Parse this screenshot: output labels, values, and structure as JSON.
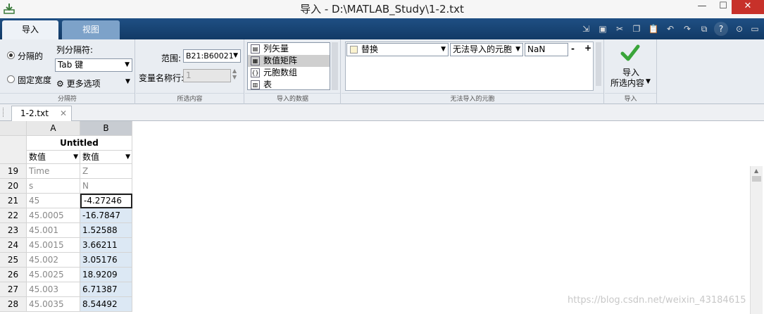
{
  "window": {
    "title": "导入 - D:\\MATLAB_Study\\1-2.txt"
  },
  "tabs": [
    {
      "label": "导入"
    },
    {
      "label": "视图"
    }
  ],
  "delimiters": {
    "delimited_label": "分隔的",
    "fixed_width_label": "固定宽度",
    "column_delimiter_label": "列分隔符:",
    "delimiter_value": "Tab 键",
    "more_options_label": "更多选项",
    "group_label": "分隔符"
  },
  "selection": {
    "range_label": "范围:",
    "range_value": "B21:B60021",
    "var_names_row_label": "变量名称行:",
    "var_names_row_value": "1",
    "group_label": "所选内容"
  },
  "output_type": {
    "items": [
      {
        "label": "列矢量"
      },
      {
        "label": "数值矩阵"
      },
      {
        "label": "元胞数组"
      },
      {
        "label": "表"
      }
    ],
    "selected_index": 1,
    "group_label": "导入的数据"
  },
  "unimportable": {
    "rule": "替换",
    "condition": "无法导入的元胞",
    "value": "NaN",
    "minus": "-",
    "plus": "+",
    "group_label": "无法导入的元胞"
  },
  "import_action": {
    "label_line1": "导入",
    "label_line2": "所选内容",
    "group_label": "导入"
  },
  "document_tab": {
    "label": "1-2.txt"
  },
  "grid": {
    "col_a": "A",
    "col_b": "B",
    "var_name": "Untitled",
    "type_a": "数值",
    "type_b": "数值",
    "rows": [
      {
        "num": "19",
        "a": "Time",
        "b": "Z"
      },
      {
        "num": "20",
        "a": "s",
        "b": "N"
      },
      {
        "num": "21",
        "a": "45",
        "b": "-4.27246"
      },
      {
        "num": "22",
        "a": "45.0005",
        "b": "-16.7847"
      },
      {
        "num": "23",
        "a": "45.001",
        "b": "1.52588"
      },
      {
        "num": "24",
        "a": "45.0015",
        "b": "3.66211"
      },
      {
        "num": "25",
        "a": "45.002",
        "b": "3.05176"
      },
      {
        "num": "26",
        "a": "45.0025",
        "b": "18.9209"
      },
      {
        "num": "27",
        "a": "45.003",
        "b": "6.71387"
      },
      {
        "num": "28",
        "a": "45.0035",
        "b": "8.54492"
      }
    ]
  },
  "watermark": "https://blog.csdn.net/weixin_43184615"
}
